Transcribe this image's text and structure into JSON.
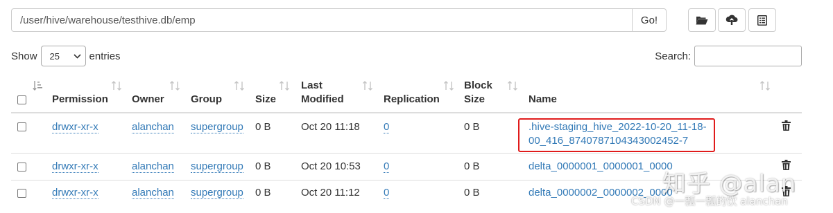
{
  "path_bar": {
    "value": "/user/hive/warehouse/testhive.db/emp",
    "go_label": "Go!"
  },
  "toolbar": {
    "icons": [
      "folder-open-icon",
      "upload-icon",
      "list-icon"
    ]
  },
  "length": {
    "show_label": "Show",
    "selected": "25",
    "entries_label": "entries"
  },
  "search": {
    "label": "Search:",
    "value": ""
  },
  "table": {
    "headers": {
      "permission": "Permission",
      "owner": "Owner",
      "group": "Group",
      "size": "Size",
      "last_modified_1": "Last",
      "last_modified_2": "Modified",
      "replication": "Replication",
      "block_size_1": "Block",
      "block_size_2": "Size",
      "name": "Name"
    },
    "rows": [
      {
        "permission": "drwxr-xr-x",
        "owner": "alanchan",
        "group": "supergroup",
        "size": "0 B",
        "last_modified": "Oct 20 11:18",
        "replication": "0",
        "block_size": "0 B",
        "name_line1": ".hive-staging_hive_2022-10-20_11-18-",
        "name_line2": "00_416_8740787104343002452-7"
      },
      {
        "permission": "drwxr-xr-x",
        "owner": "alanchan",
        "group": "supergroup",
        "size": "0 B",
        "last_modified": "Oct 20 10:53",
        "replication": "0",
        "block_size": "0 B",
        "name_line1": "delta_0000001_0000001_0000"
      },
      {
        "permission": "drwxr-xr-x",
        "owner": "alanchan",
        "group": "supergroup",
        "size": "0 B",
        "last_modified": "Oct 20 11:12",
        "replication": "0",
        "block_size": "0 B",
        "name_line1": "delta_0000002_0000002_0000"
      }
    ]
  },
  "watermarks": {
    "zhihu": "知乎 @alan",
    "csdn": "CSDN @一瓢一瓢的饮 alanchan"
  },
  "colors": {
    "link": "#337ab7",
    "highlight": "#e01b1b"
  }
}
